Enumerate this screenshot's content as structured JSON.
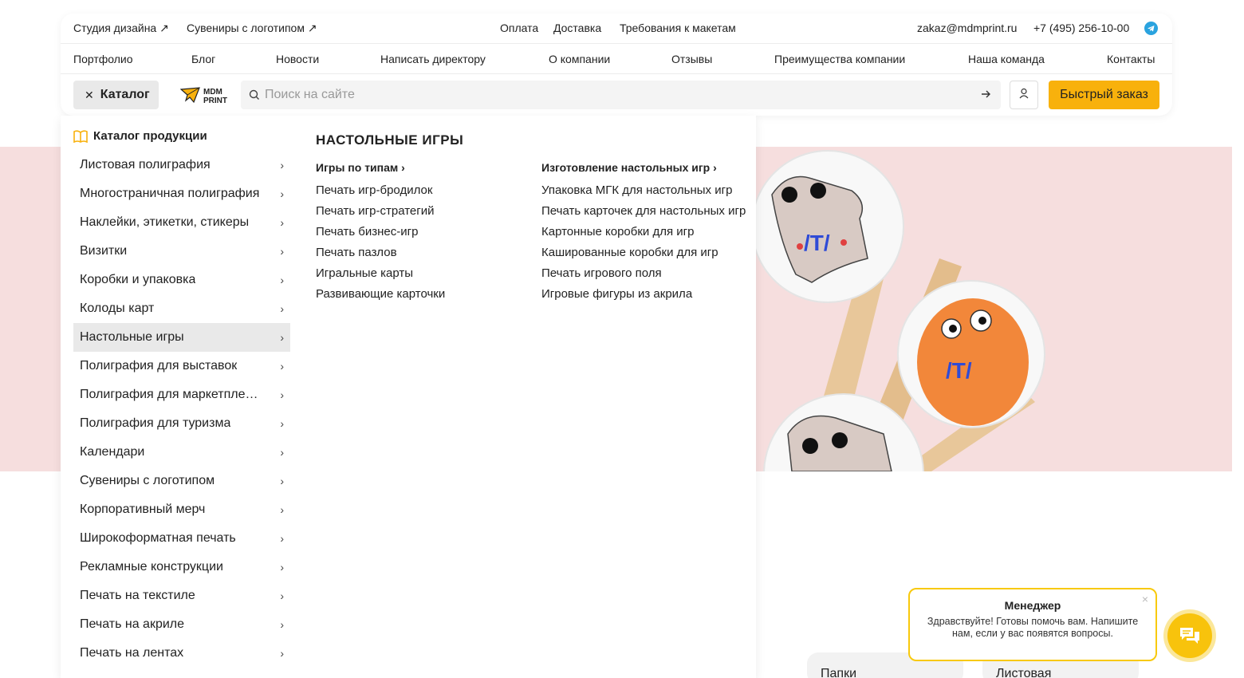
{
  "topbar": {
    "links_left": [
      "Студия дизайна ↗",
      "Сувениры с логотипом ↗"
    ],
    "links_center": [
      "Оплата",
      "Доставка",
      "Требования к макетам"
    ],
    "email": "zakaz@mdmprint.ru",
    "phone": "+7 (495) 256-10-00",
    "telegram_icon": "telegram-icon"
  },
  "nav": [
    "Портфолио",
    "Блог",
    "Новости",
    "Написать директору",
    "О компании",
    "Отзывы",
    "Преимущества компании",
    "Наша команда",
    "Контакты"
  ],
  "toolbar": {
    "catalog_label": "Каталог",
    "logo_text": [
      "MDM",
      "PRINT"
    ],
    "search_placeholder": "Поиск на сайте",
    "quick_order_label": "Быстрый заказ",
    "accent_color": "#f8b10c"
  },
  "catalog": {
    "title": "Каталог продукции",
    "items": [
      "Листовая полиграфия",
      "Многостраничная полиграфия",
      "Наклейки, этикетки, стикеры",
      "Визитки",
      "Коробки и упаковка",
      "Колоды карт",
      "Настольные игры",
      "Полиграфия для выставок",
      "Полиграфия для маркетплейсов",
      "Полиграфия для туризма",
      "Календари",
      "Сувениры с логотипом",
      "Корпоративный мерч",
      "Широкоформатная печать",
      "Рекламные конструкции",
      "Печать на текстиле",
      "Печать на акриле",
      "Печать на лентах"
    ],
    "active_index": 6
  },
  "section": {
    "title": "НАСТОЛЬНЫЕ ИГРЫ",
    "col1": {
      "heading": "Игры по типам",
      "links": [
        "Печать игр-бродилок",
        "Печать игр-стратегий",
        "Печать бизнес-игр",
        "Печать пазлов",
        "Игральные карты",
        "Развивающие карточки"
      ]
    },
    "col2": {
      "heading": "Изготовление настольных игр",
      "links": [
        "Упаковка МГК для настольных игр",
        "Печать карточек для настольных игр",
        "Картонные коробки для игр",
        "Кашированные коробки для игр",
        "Печать игрового поля",
        "Игровые фигуры из акрила"
      ]
    }
  },
  "bottom_cards": [
    "Папки",
    "Листовая"
  ],
  "chat": {
    "title": "Менеджер",
    "text": "Здравствуйте! Готовы помочь вам. Напишите нам, если у вас появятся вопросы.",
    "close": "×"
  }
}
